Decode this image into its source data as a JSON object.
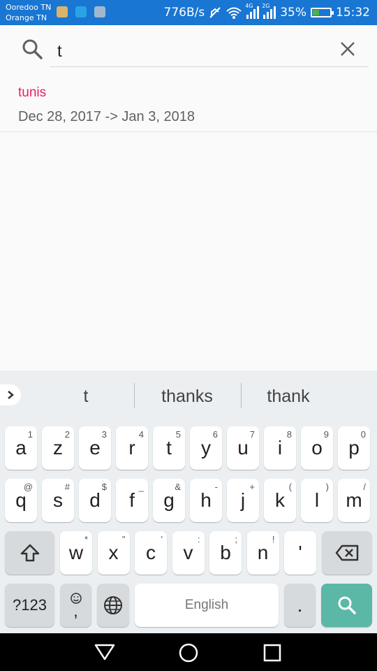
{
  "status_bar": {
    "carrier_1": "Ooredoo TN",
    "carrier_2": "Orange TN",
    "net_speed": "776B/s",
    "sig1_type": "4G",
    "sig2_type": "2G",
    "battery_percent": "35%",
    "battery_level": 0.35,
    "time": "15:32",
    "notification_icons": [
      "sim-card-icon",
      "usb-icon",
      "image-icon"
    ],
    "colors": {
      "background": "#1976d2",
      "battery_fill": "#4caf50"
    }
  },
  "search": {
    "query": "t",
    "icon": "search-icon",
    "clear_icon": "close-icon"
  },
  "results": [
    {
      "title": "tunis",
      "dates": "Dec 28, 2017  -> Jan 3, 2018"
    }
  ],
  "keyboard": {
    "suggestions": [
      "t",
      "thanks",
      "thank"
    ],
    "row1": [
      {
        "k": "a",
        "h": "1"
      },
      {
        "k": "z",
        "h": "2"
      },
      {
        "k": "e",
        "h": "3"
      },
      {
        "k": "r",
        "h": "4"
      },
      {
        "k": "t",
        "h": "5"
      },
      {
        "k": "y",
        "h": "6"
      },
      {
        "k": "u",
        "h": "7"
      },
      {
        "k": "i",
        "h": "8"
      },
      {
        "k": "o",
        "h": "9"
      },
      {
        "k": "p",
        "h": "0"
      }
    ],
    "row2": [
      {
        "k": "q",
        "h": "@"
      },
      {
        "k": "s",
        "h": "#"
      },
      {
        "k": "d",
        "h": "$"
      },
      {
        "k": "f",
        "h": "_"
      },
      {
        "k": "g",
        "h": "&"
      },
      {
        "k": "h",
        "h": "-"
      },
      {
        "k": "j",
        "h": "+"
      },
      {
        "k": "k",
        "h": "("
      },
      {
        "k": "l",
        "h": ")"
      },
      {
        "k": "m",
        "h": "/"
      }
    ],
    "row3": [
      {
        "k": "w",
        "h": "*"
      },
      {
        "k": "x",
        "h": "\""
      },
      {
        "k": "c",
        "h": "'"
      },
      {
        "k": "v",
        "h": ":"
      },
      {
        "k": "b",
        "h": ";"
      },
      {
        "k": "n",
        "h": "!"
      },
      {
        "k": "'",
        "h": ""
      }
    ],
    "sym_key": "?123",
    "emoji_key": ",",
    "space_label": "English",
    "period_key": ".",
    "colors": {
      "search_key": "#5bb8a7",
      "background": "#eceff1"
    }
  },
  "nav_bar": {
    "icons": [
      "back-triangle-icon",
      "home-circle-icon",
      "recents-square-icon"
    ]
  }
}
